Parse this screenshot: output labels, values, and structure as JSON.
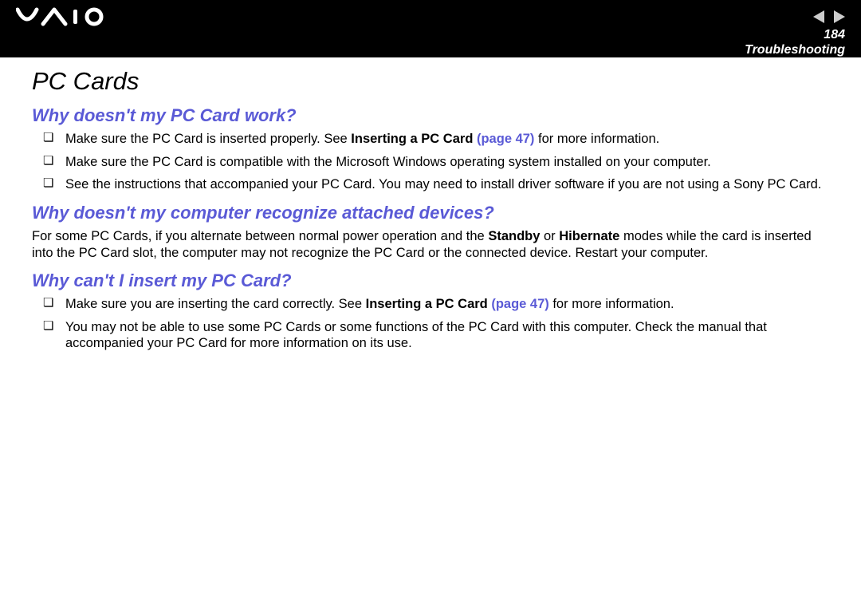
{
  "header": {
    "page_number": "184",
    "section": "Troubleshooting"
  },
  "content": {
    "title": "PC Cards",
    "q1": {
      "heading": "Why doesn't my PC Card work?",
      "b1_pre": "Make sure the PC Card is inserted properly. See ",
      "b1_bold": "Inserting a PC Card ",
      "b1_link": "(page 47)",
      "b1_post": " for more information.",
      "b2": "Make sure the PC Card is compatible with the Microsoft Windows operating system installed on your computer.",
      "b3": "See the instructions that accompanied your PC Card. You may need to install driver software if you are not using a Sony PC Card."
    },
    "q2": {
      "heading": "Why doesn't my computer recognize attached devices?",
      "p_pre": "For some PC Cards, if you alternate between normal power operation and the ",
      "p_standby": "Standby",
      "p_mid1": " or ",
      "p_hibernate": "Hibernate",
      "p_post": " modes while the card is inserted into the PC Card slot, the computer may not recognize the PC Card or the connected device. Restart your computer."
    },
    "q3": {
      "heading": "Why can't I insert my PC Card?",
      "b1_pre": "Make sure you are inserting the card correctly. See ",
      "b1_bold": "Inserting a PC Card ",
      "b1_link": "(page 47)",
      "b1_post": " for more information.",
      "b2": "You may not be able to use some PC Cards or some functions of the PC Card with this computer. Check the manual that accompanied your PC Card for more information on its use."
    }
  }
}
